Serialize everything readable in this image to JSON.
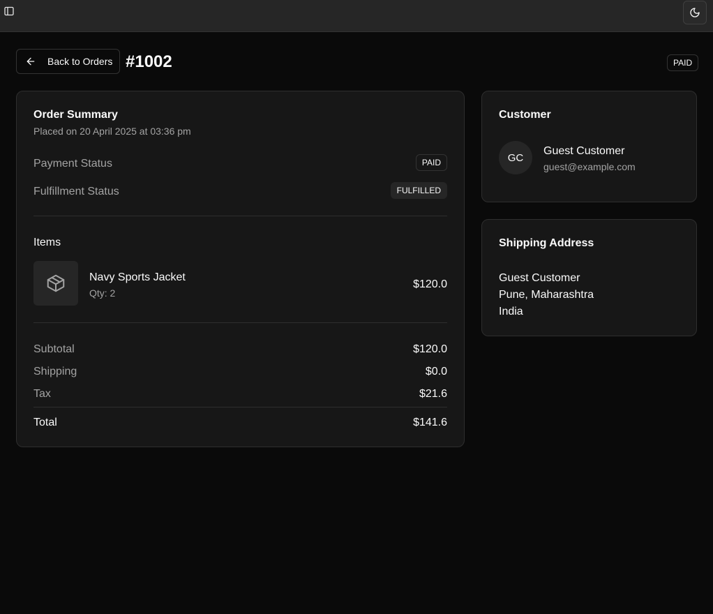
{
  "header": {
    "back_label": "Back to Orders",
    "order_number": "#1002",
    "status_badge": "PAID"
  },
  "icons": {
    "sidebar_toggle": "sidebar-icon",
    "theme_toggle": "moon-icon",
    "back": "arrow-left-icon",
    "item": "package-icon"
  },
  "summary": {
    "title": "Order Summary",
    "placed_on": "Placed on 20 April 2025 at 03:36 pm",
    "payment_status_label": "Payment Status",
    "payment_status_value": "PAID",
    "fulfillment_status_label": "Fulfillment Status",
    "fulfillment_status_value": "FULFILLED",
    "items_heading": "Items",
    "items": [
      {
        "name": "Navy Sports Jacket",
        "qty": "Qty: 2",
        "price": "$120.0"
      }
    ],
    "totals": {
      "subtotal_label": "Subtotal",
      "subtotal_value": "$120.0",
      "shipping_label": "Shipping",
      "shipping_value": "$0.0",
      "tax_label": "Tax",
      "tax_value": "$21.6",
      "total_label": "Total",
      "total_value": "$141.6"
    }
  },
  "customer": {
    "title": "Customer",
    "initials": "GC",
    "name": "Guest Customer",
    "email": "guest@example.com"
  },
  "shipping": {
    "title": "Shipping Address",
    "line1": "Guest Customer",
    "line2": "Pune, Maharashtra",
    "line3": "India"
  },
  "colors": {
    "background": "#0a0a0a",
    "card": "#171717",
    "border": "#2e2e2e",
    "muted_text": "#a3a3a3",
    "text": "#fafafa"
  }
}
